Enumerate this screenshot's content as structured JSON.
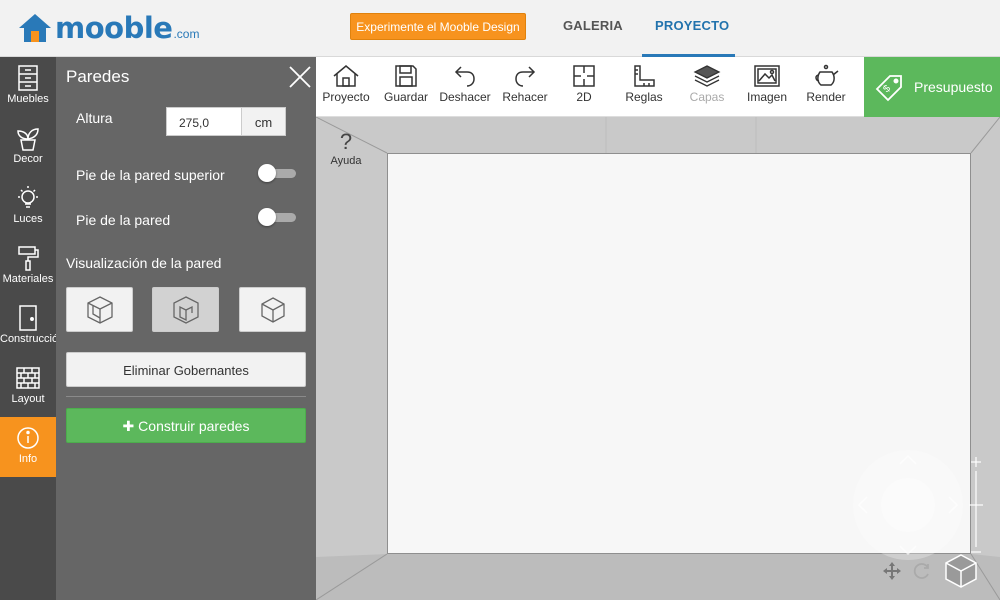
{
  "header": {
    "logo_text": "mooble",
    "logo_suffix": ".com",
    "cta_label": "Experimente el Mooble Design",
    "tabs": [
      {
        "label": "GALERIA",
        "active": false
      },
      {
        "label": "PROYECTO",
        "active": true
      }
    ]
  },
  "sidebar": {
    "items": [
      {
        "label": "Muebles",
        "icon": "cabinet-icon"
      },
      {
        "label": "Decor",
        "icon": "plant-icon"
      },
      {
        "label": "Luces",
        "icon": "lightbulb-icon"
      },
      {
        "label": "Materiales",
        "icon": "paint-roller-icon"
      },
      {
        "label": "Construcción",
        "icon": "door-icon"
      },
      {
        "label": "Layout",
        "icon": "brick-wall-icon"
      },
      {
        "label": "Info",
        "icon": "info-icon",
        "active": true
      }
    ]
  },
  "panel": {
    "title": "Paredes",
    "height_label": "Altura",
    "height_value": "275,0",
    "height_unit": "cm",
    "toggle_top_label": "Pie de la pared superior",
    "toggle_top_value": false,
    "toggle_wall_label": "Pie de la pared",
    "toggle_wall_value": false,
    "visualization_label": "Visualización de la pared",
    "remove_button": "Eliminar Gobernantes",
    "build_button": "Construir paredes"
  },
  "toolbar": {
    "items": [
      {
        "label": "Proyecto",
        "icon": "home-icon"
      },
      {
        "label": "Guardar",
        "icon": "save-icon"
      },
      {
        "label": "Deshacer",
        "icon": "undo-icon"
      },
      {
        "label": "Rehacer",
        "icon": "redo-icon"
      },
      {
        "label": "2D",
        "icon": "floorplan-icon"
      },
      {
        "label": "Reglas",
        "icon": "ruler-icon"
      },
      {
        "label": "Capas",
        "icon": "layers-icon",
        "disabled": true
      },
      {
        "label": "Imagen",
        "icon": "image-icon"
      },
      {
        "label": "Render",
        "icon": "teapot-icon"
      }
    ],
    "quote_label": "Presupuesto"
  },
  "canvas": {
    "help_label": "Ayuda"
  },
  "colors": {
    "brand_blue": "#2979b8",
    "accent_orange": "#f7931e",
    "success_green": "#5cb85c",
    "sidebar_dark": "#4a4a4a",
    "panel_gray": "#666666"
  }
}
